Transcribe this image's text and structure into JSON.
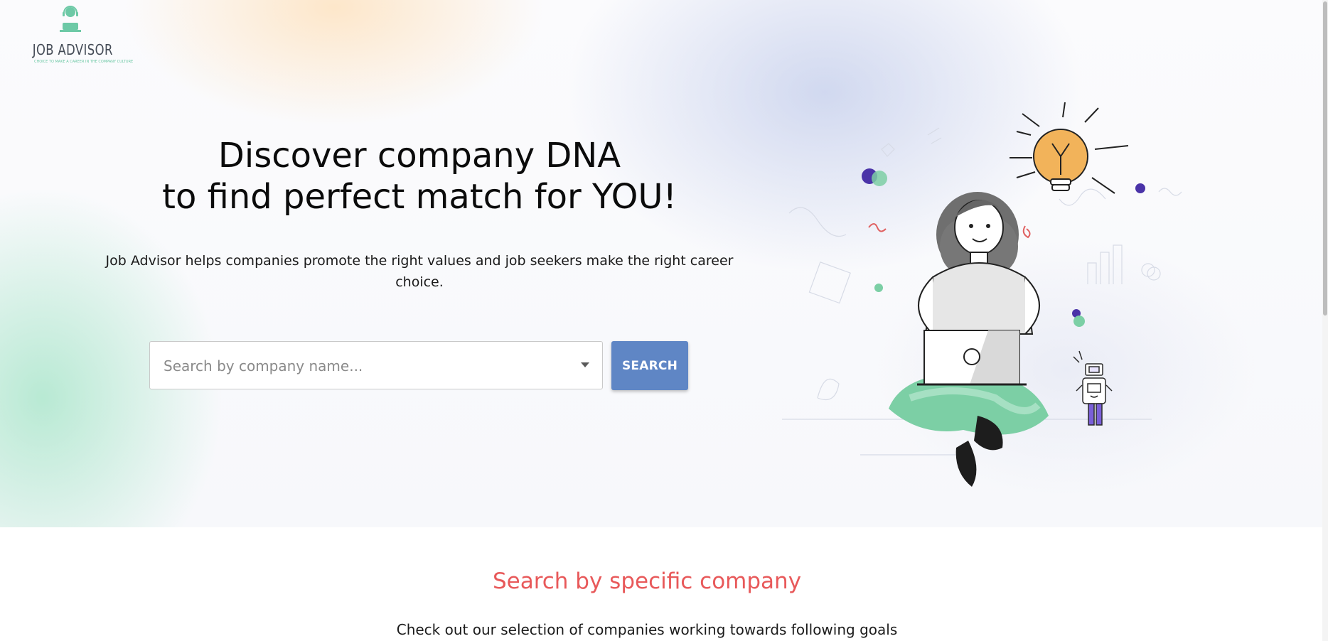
{
  "brand": {
    "name": "JOB ADVISOR",
    "tagline": "CHOICE TO MAKE A CAREER IN THE COMPANY CULTURE"
  },
  "hero": {
    "headline_line1": "Discover company DNA",
    "headline_line2": "to find perfect match for YOU!",
    "subtext": "Job Advisor helps companies promote the right values and job seekers make the right career choice."
  },
  "search": {
    "placeholder": "Search by company name...",
    "value": "",
    "button_label": "SEARCH"
  },
  "section": {
    "title": "Search by specific company",
    "subtitle": "Check out our selection of companies working towards following goals"
  },
  "colors": {
    "accent_button": "#5f86c5",
    "section_title": "#e8595a",
    "brand_green": "#6dc9a6",
    "illustration_green": "#7ccfa5",
    "bulb_orange": "#f2b35a",
    "purple": "#4a33a8"
  },
  "icons": {
    "logo": "person-with-headset-at-laptop-icon",
    "dropdown": "chevron-down-icon",
    "illustration": "woman-with-laptop-robot-lightbulb-illustration"
  }
}
